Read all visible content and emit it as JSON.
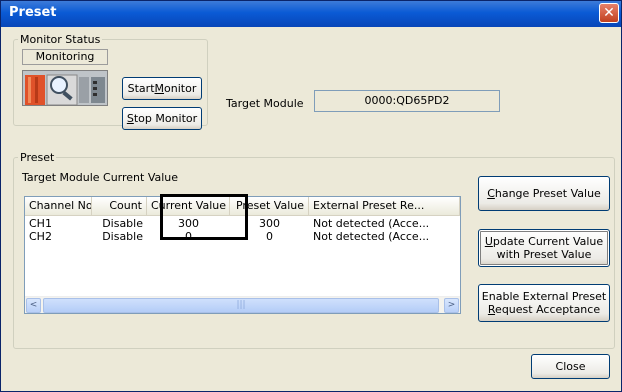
{
  "window": {
    "title": "Preset",
    "close_glyph": "✕"
  },
  "monitor_status": {
    "legend": "Monitor Status",
    "state_label": "Monitoring",
    "start_button_pre": "Start ",
    "start_button_u": "M",
    "start_button_post": "onitor",
    "stop_button_u": "S",
    "stop_button_post": "top Monitor",
    "image_icon": "monitoring-animation-icon"
  },
  "target_module": {
    "label": "Target Module",
    "value": "0000:QD65PD2"
  },
  "preset": {
    "legend": "Preset",
    "list_caption": "Target Module Current Value",
    "columns": [
      "Channel No.",
      "Count",
      "Current Value",
      "Preset Value",
      "External Preset Re..."
    ],
    "rows": [
      [
        "CH1",
        "Disable",
        "300",
        "300",
        "Not detected (Acce..."
      ],
      [
        "CH2",
        "Disable",
        "0",
        "0",
        "Not detected (Acce..."
      ]
    ],
    "scroll_left_icon": "<",
    "scroll_right_icon": ">",
    "scroll_grip": "|||"
  },
  "buttons": {
    "change_u": "C",
    "change_post": "hange Preset Value",
    "update_u": "U",
    "update_post": "pdate Current Value",
    "update_line2": "with Preset Value",
    "enable_line1": "Enable External Preset",
    "enable_u": "R",
    "enable_post": "equest Acceptance",
    "close": "Close"
  }
}
